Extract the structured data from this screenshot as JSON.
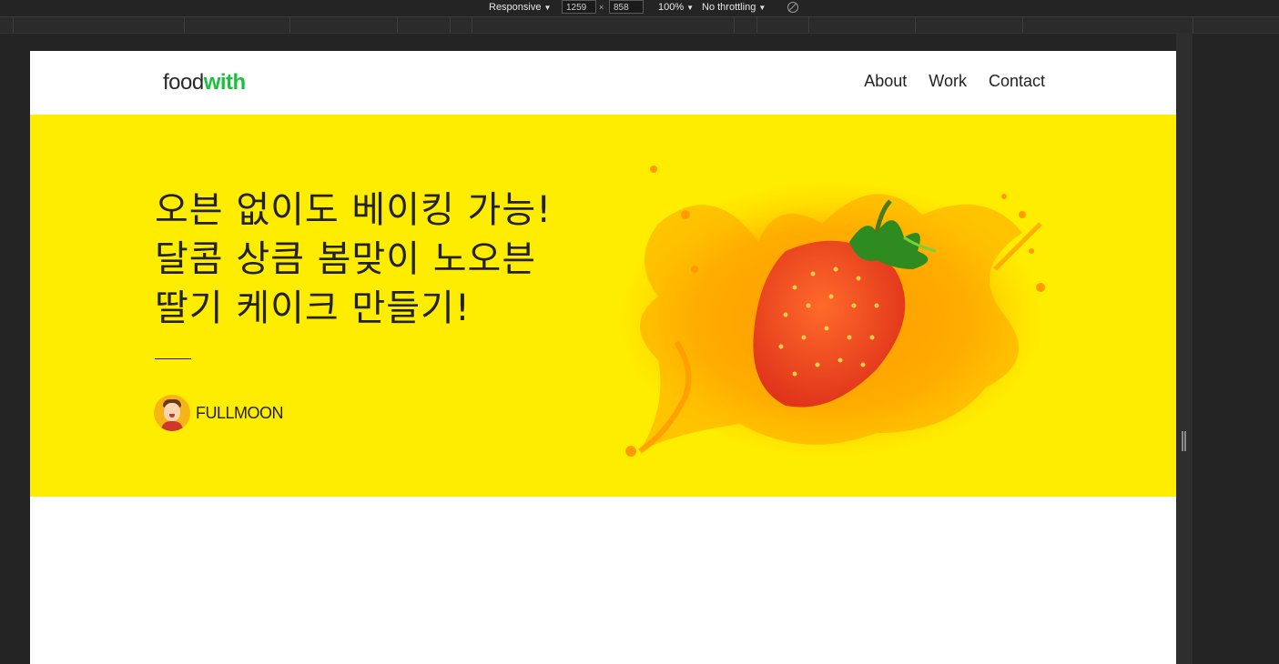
{
  "devtools": {
    "device": "Responsive",
    "width": "1259",
    "height": "858",
    "zoom": "100%",
    "throttling": "No throttling",
    "times": "×"
  },
  "site": {
    "logo_food": "food",
    "logo_with": "with",
    "brand_color": "#18c23a",
    "nav": [
      {
        "label": "About"
      },
      {
        "label": "Work"
      },
      {
        "label": "Contact"
      }
    ]
  },
  "hero": {
    "background": "#ffed00",
    "title_lines": [
      "오븐 없이도 베이킹 가능!",
      "달콤 상큼 봄맞이 노오븐",
      "딸기 케이크 만들기!"
    ],
    "author": "FULLMOON",
    "image_icon": "strawberry-splash"
  }
}
